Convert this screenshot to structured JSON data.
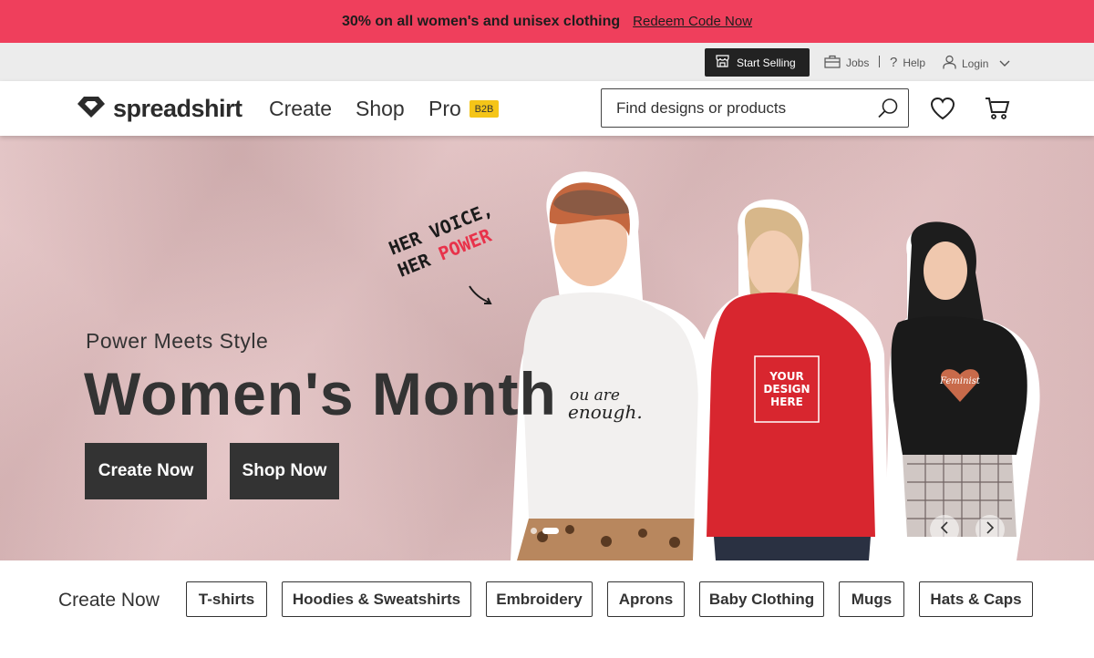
{
  "promo": {
    "text": "30% on all women's and unisex clothing",
    "link": "Redeem Code Now",
    "color": "#ef3f5c"
  },
  "utility": {
    "start_selling": "Start Selling",
    "jobs": "Jobs",
    "help": "Help",
    "login": "Login"
  },
  "nav": {
    "logo": "spreadshirt",
    "links": [
      "Create",
      "Shop",
      "Pro"
    ],
    "badge": "B2B",
    "search_placeholder": "Find designs or products",
    "icons": [
      "search-icon",
      "heart-icon",
      "cart-icon"
    ]
  },
  "hero": {
    "scribble_line1": "HER VOICE,",
    "scribble_line2a": "HER ",
    "scribble_line2b": "POWER",
    "subtitle": "Power Meets Style",
    "title": "Women's Month",
    "buttons": [
      "Create Now",
      "Shop Now"
    ],
    "slides": 2,
    "active_slide": 1,
    "shirt_texts": [
      "YOU ARE enough.",
      "YOUR DESIGN HERE",
      "Feminist"
    ],
    "background_color": "#e1bcbd"
  },
  "categories": {
    "label": "Create Now",
    "items": [
      "T-shirts",
      "Hoodies & Sweatshirts",
      "Embroidery",
      "Aprons",
      "Baby Clothing",
      "Mugs",
      "Hats & Caps"
    ]
  }
}
